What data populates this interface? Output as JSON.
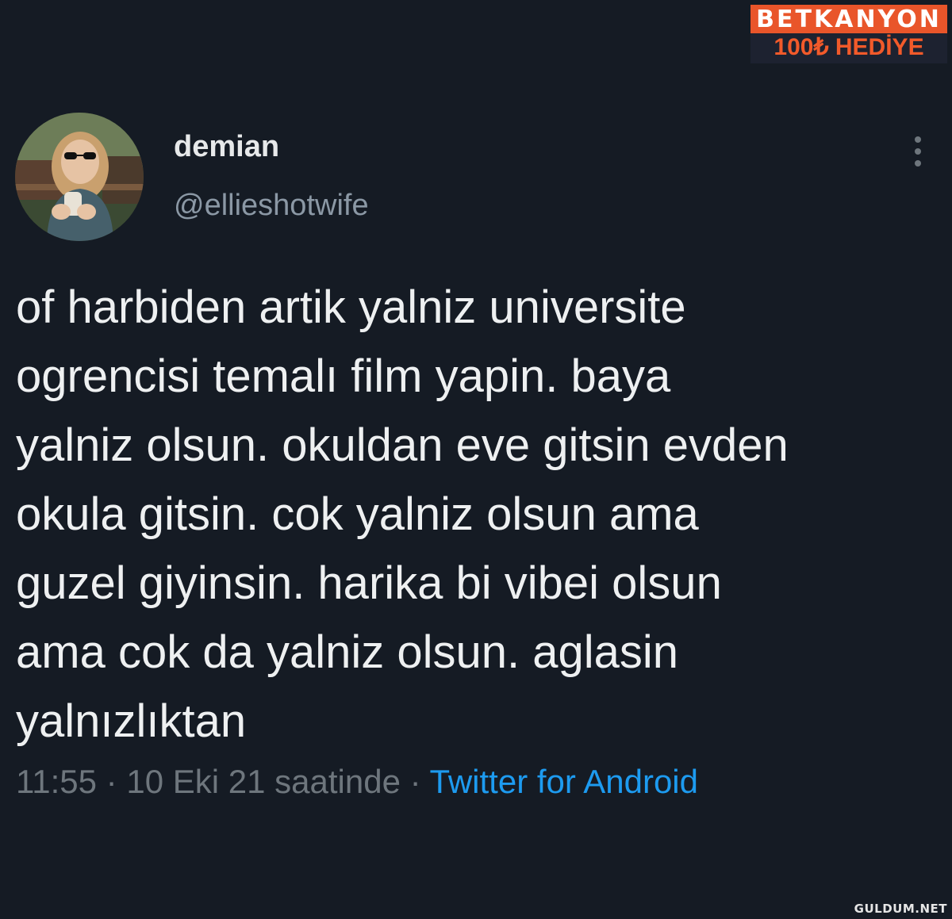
{
  "promo": {
    "brand": "BETKANYON",
    "offer": "100₺ HEDİYE"
  },
  "tweet": {
    "author": {
      "display_name": "demian",
      "handle": "@ellieshotwife",
      "avatar_icon": "profile-photo"
    },
    "more_icon": "more-vertical-icon",
    "text": "of harbiden artik yalniz universite\nogrencisi temalı film yapin. baya\nyalniz olsun. okuldan eve gitsin evden\nokula gitsin. cok yalniz olsun ama\nguzel giyinsin. harika bi vibei olsun\nama cok da yalniz olsun. aglasin\nyalnızlıktan",
    "time": "11:55",
    "separator": "·",
    "date": "10 Eki 21 saatinde",
    "source": "Twitter for Android"
  },
  "watermark": "GULDUM.NET",
  "colors": {
    "background": "#151b24",
    "text": "#e7e9ea",
    "secondary": "#8b98a5",
    "link": "#1d9bf0",
    "brand_orange": "#e9552a"
  }
}
